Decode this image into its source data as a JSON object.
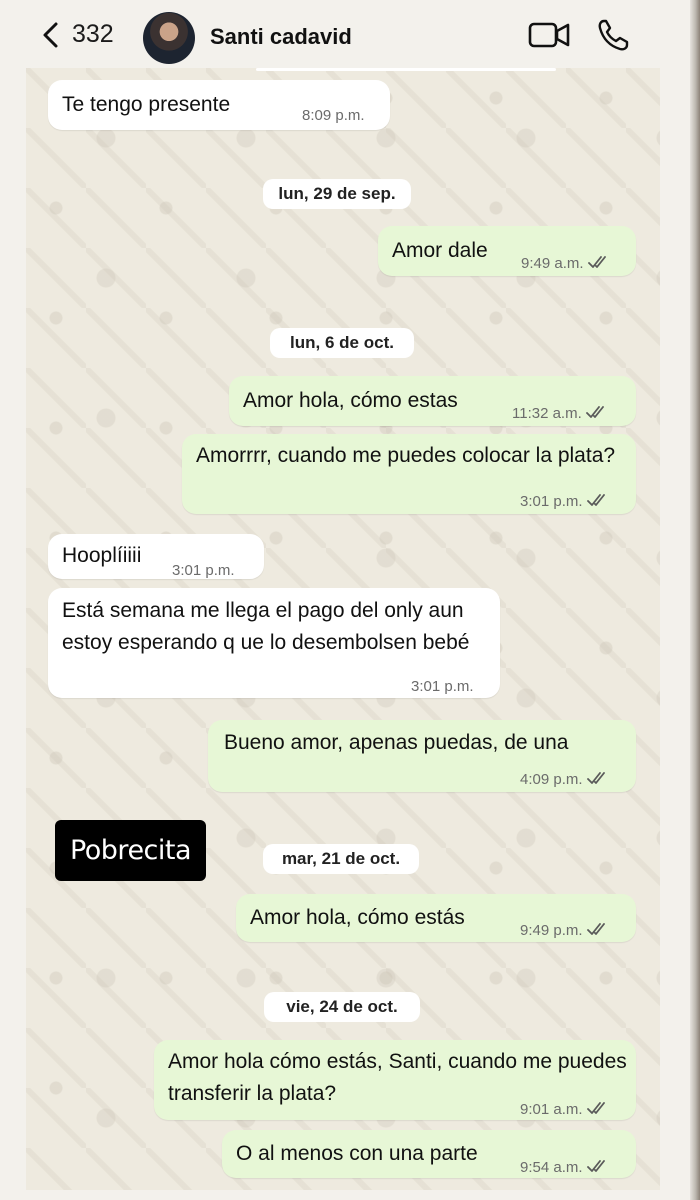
{
  "header": {
    "back_count": "332",
    "contact_name": "Santi cadavid"
  },
  "colors": {
    "incoming_bubble": "#ffffff",
    "outgoing_bubble": "#e7f7d6",
    "read_ticks": "#5a5a5a",
    "chat_background": "#eeeadf"
  },
  "messages": [
    {
      "dir": "in",
      "text": "Te tengo presente",
      "time": "8:09 p.m."
    },
    {
      "date": "lun, 29 de sep."
    },
    {
      "dir": "out",
      "text": "Amor dale",
      "time": "9:49 a.m."
    },
    {
      "date": "lun, 6 de oct."
    },
    {
      "dir": "out",
      "text": "Amor hola, cómo estas",
      "time": "11:32 a.m."
    },
    {
      "dir": "out",
      "text": "Amorrrr, cuando me puedes colocar la plata?",
      "time": "3:01 p.m."
    },
    {
      "dir": "in",
      "text": "Hooplíiiii",
      "time": "3:01 p.m."
    },
    {
      "dir": "in",
      "text": "Está semana me llega el pago del only aun estoy esperando q ue lo desembolsen bebé",
      "time": "3:01 p.m."
    },
    {
      "dir": "out",
      "text": "Bueno amor, apenas puedas, de una",
      "time": "4:09 p.m."
    },
    {
      "date": "mar, 21 de oct."
    },
    {
      "dir": "out",
      "text": "Amor hola, cómo estás",
      "time": "9:49 p.m."
    },
    {
      "date": "vie, 24 de oct."
    },
    {
      "dir": "out",
      "text": "Amor hola cómo estás, Santi, cuando me puedes transferir la plata?",
      "time": "9:01 a.m."
    },
    {
      "dir": "out",
      "text": "O al menos con una parte",
      "time": "9:54 a.m."
    }
  ],
  "overlay_caption": "Pobrecita"
}
